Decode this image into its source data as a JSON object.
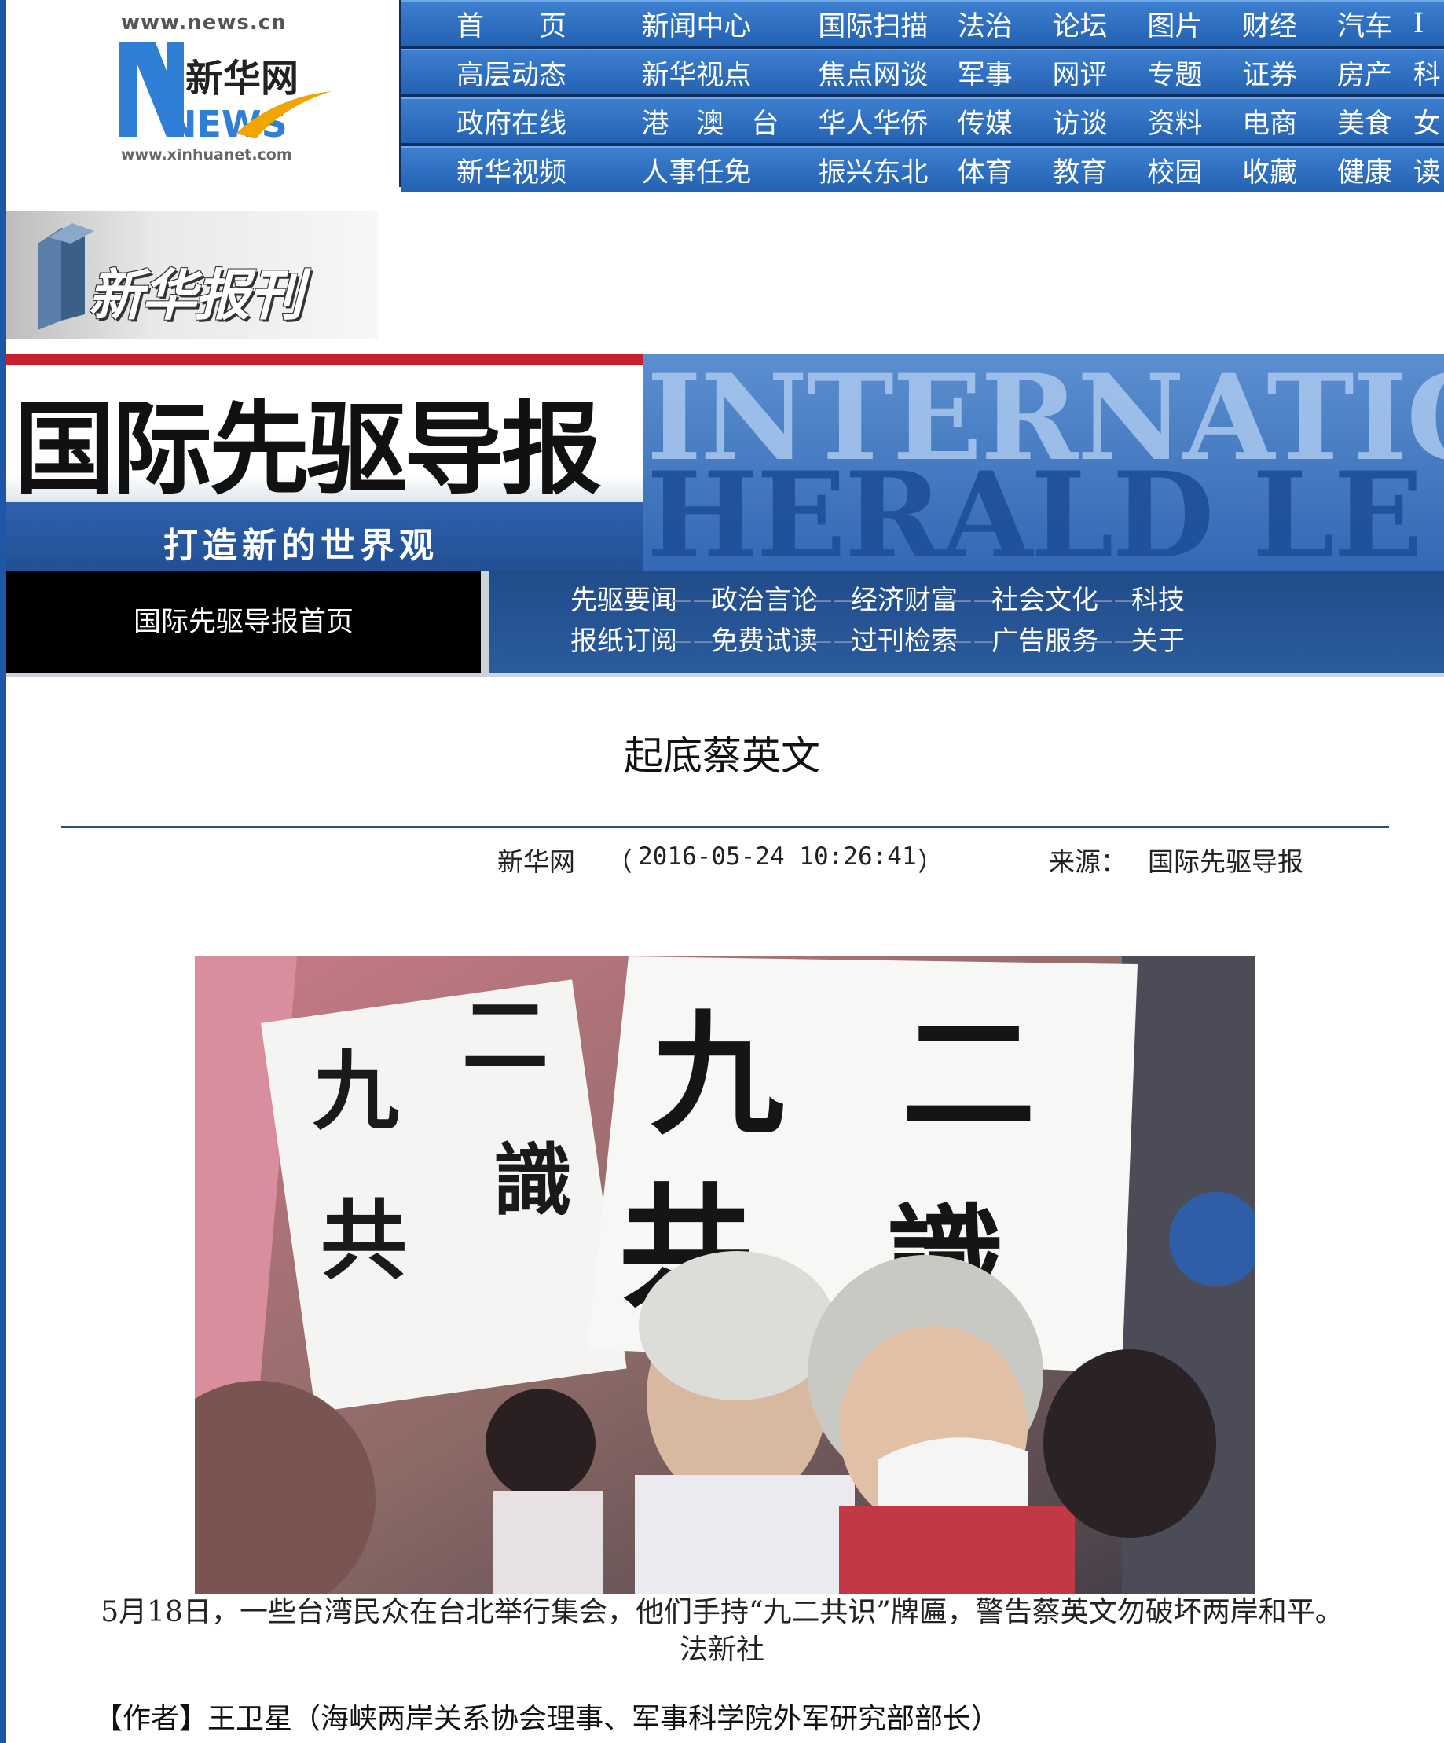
{
  "logo": {
    "url_top": "www.news.cn",
    "url_bottom": "www.xinhuanet.com",
    "brand": "新华网",
    "letters": "NEWS"
  },
  "top_nav": {
    "rows": [
      [
        "首　　页",
        "新闻中心",
        "国际扫描",
        "法治",
        "论坛",
        "图片",
        "财经",
        "汽车",
        "I"
      ],
      [
        "高层动态",
        "新华视点",
        "焦点网谈",
        "军事",
        "网评",
        "专题",
        "证券",
        "房产",
        "科"
      ],
      [
        "政府在线",
        "港　澳　台",
        "华人华侨",
        "传媒",
        "访谈",
        "资料",
        "电商",
        "美食",
        "女"
      ],
      [
        "新华视频",
        "人事任免",
        "振兴东北",
        "体育",
        "教育",
        "校园",
        "收藏",
        "健康",
        "读"
      ]
    ]
  },
  "paper_banner": {
    "title": "新华报刊"
  },
  "masthead": {
    "cn_title": "国际先驱导报",
    "slogan": "打造新的世界观",
    "en_line1": "INTERNATIO",
    "en_line2": "HERALD LE"
  },
  "section_nav": {
    "home": "国际先驱导报首页",
    "separator": "——",
    "row1": [
      "先驱要闻",
      "政治言论",
      "经济财富",
      "社会文化",
      "科技"
    ],
    "row2": [
      "报纸订阅",
      "免费试读",
      "过刊检索",
      "广告服务",
      "关于"
    ]
  },
  "article": {
    "title": "起底蔡英文",
    "site": "新华网",
    "paren_open": "（",
    "datetime": "2016-05-24 10:26:41",
    "paren_close": "）",
    "source_label": "来源：",
    "source": "国际先驱导报",
    "photo_signs": {
      "sign1": [
        "九",
        "二",
        "共",
        "識"
      ],
      "sign2": [
        "九",
        "二",
        "共",
        "識"
      ]
    },
    "caption": "5月18日，一些台湾民众在台北举行集会，他们手持“九二共识”牌匾，警告蔡英文勿破坏两岸和平。法新社",
    "author_label": "【作者】",
    "author": "王卫星（海峡两岸关系协会理事、军事科学院外军研究部部长）"
  },
  "colors": {
    "nav_blue": "#2a68b8",
    "nav_dark": "#0f2d5e",
    "masthead_red": "#c8202d",
    "masthead_blue": "#2d5faa",
    "rule": "#2a4f7d"
  }
}
